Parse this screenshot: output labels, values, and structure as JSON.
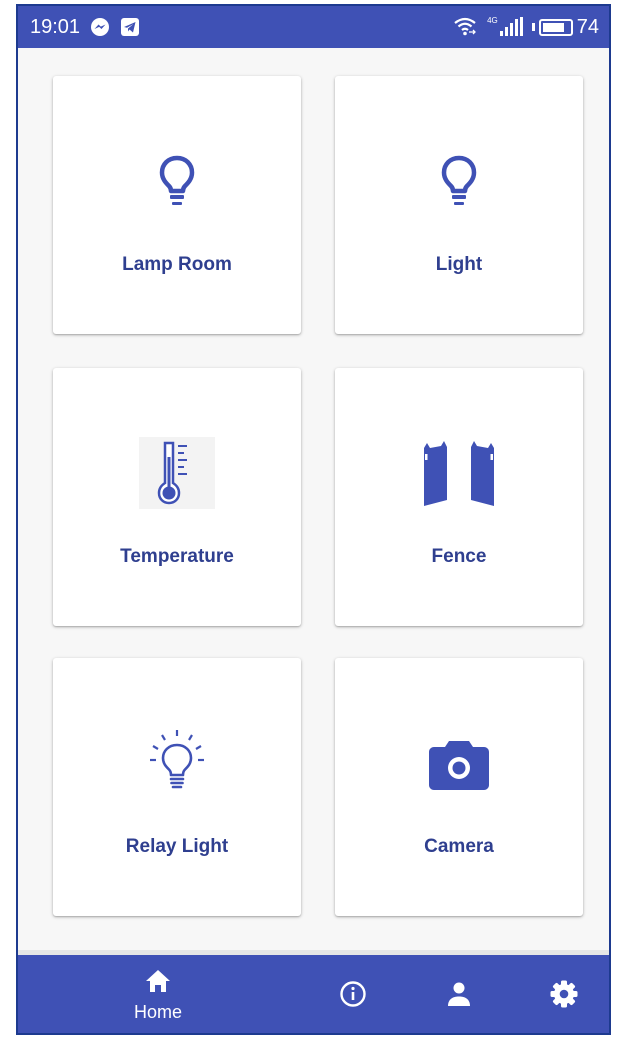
{
  "status_bar": {
    "time": "19:01",
    "network_label": "4G",
    "battery_level": "74"
  },
  "cards": [
    {
      "label": "Lamp Room",
      "icon": "lightbulb-icon"
    },
    {
      "label": "Light",
      "icon": "lightbulb-icon"
    },
    {
      "label": "Temperature",
      "icon": "thermometer-icon"
    },
    {
      "label": "Fence",
      "icon": "gate-icon"
    },
    {
      "label": "Relay Light",
      "icon": "lightbulb-on-icon"
    },
    {
      "label": "Camera",
      "icon": "camera-icon"
    }
  ],
  "bottom_nav": {
    "items": [
      {
        "label": "Home",
        "icon": "home-icon",
        "active": true
      },
      {
        "label": "",
        "icon": "info-icon"
      },
      {
        "label": "",
        "icon": "person-icon"
      },
      {
        "label": "",
        "icon": "settings-icon"
      }
    ]
  },
  "colors": {
    "primary": "#3f51b5",
    "card_text": "#2f3f8f",
    "icon": "#3f51b5",
    "background": "#f7f7f7"
  }
}
